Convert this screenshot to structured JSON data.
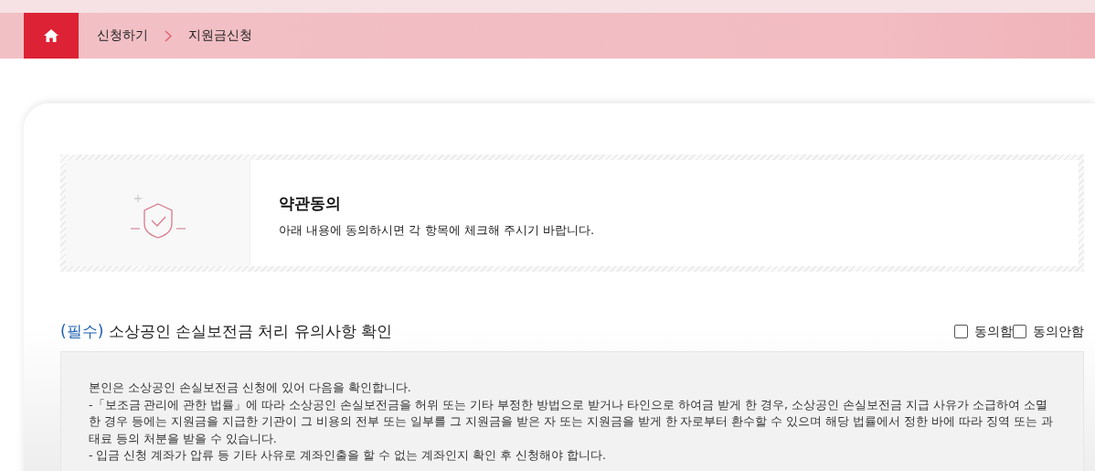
{
  "breadcrumb": {
    "items": [
      "신청하기",
      "지원금신청"
    ]
  },
  "intro": {
    "title": "약관동의",
    "text": "아래 내용에 동의하시면 각 항목에 체크해 주시기 바랍니다."
  },
  "terms": [
    {
      "required_label": "(필수)",
      "title": "소상공인 손실보전금 처리 유의사항 확인",
      "options": [
        {
          "label": "동의함",
          "checked": false
        },
        {
          "label": "동의안함",
          "checked": false
        }
      ],
      "lines": [
        "본인은 소상공인 손실보전금 신청에 있어 다음을 확인합니다.",
        "-「보조금 관리에 관한 법률」에 따라 소상공인 손실보전금을 허위 또는 기타 부정한 방법으로 받거나 타인으로 하여금 받게 한 경우, 소상공인 손실보전금 지급 사유가 소급하여 소멸한 경우 등에는 지원금을 지급한 기관이 그 비용의 전부 또는 일부를 그 지원금을 받은 자 또는 지원금을 받게 한 자로부터 환수할 수 있으며 해당 법률에서 정한 바에 따라 징역 또는 과태료 등의 처분을 받을 수 있습니다.",
        "- 입금 신청 계좌가 압류 등 기타 사유로 계좌인출을 할 수 없는 계좌인지 확인 후 신청해야 합니다."
      ]
    }
  ]
}
